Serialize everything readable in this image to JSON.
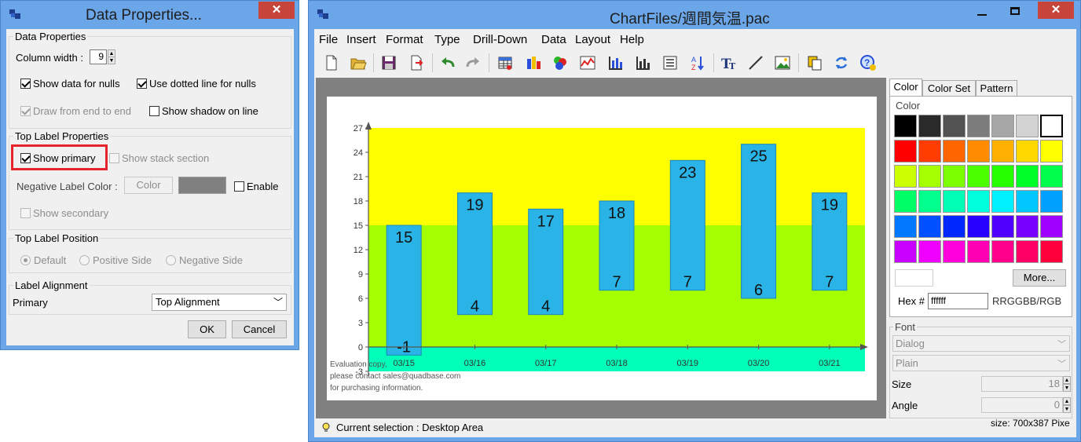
{
  "dialog": {
    "title": "Data Properties...",
    "close": "✕",
    "data_properties": {
      "legend": "Data Properties",
      "column_width_label": "Column width :",
      "column_width_value": "9",
      "show_data_for_nulls": "Show data for nulls",
      "use_dotted_line": "Use dotted line for nulls",
      "draw_from_end": "Draw from end to end",
      "show_shadow": "Show shadow on line"
    },
    "top_label_properties": {
      "legend": "Top Label Properties",
      "show_primary": "Show primary",
      "show_stack_section": "Show stack section",
      "negative_label_color": "Negative Label Color :",
      "color_button": "Color",
      "enable": "Enable",
      "show_secondary": "Show secondary"
    },
    "top_label_position": {
      "legend": "Top Label Position",
      "default": "Default",
      "positive_side": "Positive Side",
      "negative_side": "Negative Side"
    },
    "label_alignment": {
      "legend": "Label Alignment",
      "primary_label": "Primary",
      "primary_value": "Top Alignment"
    },
    "ok": "OK",
    "cancel": "Cancel"
  },
  "main": {
    "title": "ChartFiles/週間気温.pac",
    "menu": [
      "File",
      "Insert",
      "Format",
      "Type",
      "Drill-Down",
      "Data",
      "Layout",
      "Help"
    ],
    "status": "Current selection : Desktop Area",
    "size_text": "size: 700x387 Pixe",
    "watermark": [
      "Evaluation copy,",
      "please contact sales@quadbase.com",
      "for purchasing information."
    ]
  },
  "panel": {
    "tabs": [
      "Color",
      "Color Set",
      "Pattern"
    ],
    "color_group": "Color",
    "more_button": "More...",
    "hex_label": "Hex #",
    "hex_value": "ffffff",
    "hex_format": "RRGGBB/RGB",
    "font_group": "Font",
    "font_name": "Dialog",
    "font_style": "Plain",
    "size_label": "Size",
    "size_value": "18",
    "angle_label": "Angle",
    "angle_value": "0",
    "palette": [
      [
        "#000000",
        "#2a2a2a",
        "#525252",
        "#7c7c7c",
        "#a6a6a6",
        "#d2d2d2",
        "#ffffff"
      ],
      [
        "#ff0000",
        "#ff3c00",
        "#ff6600",
        "#ff8c00",
        "#ffb000",
        "#ffd800",
        "#ffff00"
      ],
      [
        "#ccff00",
        "#a6ff00",
        "#7cff00",
        "#4cff00",
        "#26ff00",
        "#00ff26",
        "#00ff4c"
      ],
      [
        "#00ff66",
        "#00ff8c",
        "#00ffb4",
        "#00ffdc",
        "#00f0ff",
        "#00c8ff",
        "#00a0ff"
      ],
      [
        "#0078ff",
        "#0050ff",
        "#0028ff",
        "#2800ff",
        "#5000ff",
        "#7800ff",
        "#a000ff"
      ],
      [
        "#c800ff",
        "#f000ff",
        "#ff00dc",
        "#ff00b4",
        "#ff008c",
        "#ff0064",
        "#ff003c"
      ]
    ]
  },
  "chart_data": {
    "type": "bar",
    "categories": [
      "03/15",
      "03/16",
      "03/17",
      "03/18",
      "03/19",
      "03/20",
      "03/21"
    ],
    "high": [
      15,
      19,
      17,
      18,
      23,
      25,
      19
    ],
    "low": [
      -1,
      4,
      4,
      7,
      7,
      6,
      7
    ],
    "ylim": [
      -3,
      27
    ],
    "yticks": [
      "27",
      "24",
      "21",
      "18",
      "15",
      "12",
      "9",
      "6",
      "3",
      "0",
      "-3"
    ],
    "bands": [
      {
        "from": 15,
        "to": 27,
        "color": "#ffff00"
      },
      {
        "from": 0,
        "to": 15,
        "color": "#a6ff00"
      },
      {
        "from": -3,
        "to": 0,
        "color": "#00ffb8"
      }
    ],
    "bar_color": "#2ab3e6",
    "accent": "#e8222a"
  }
}
